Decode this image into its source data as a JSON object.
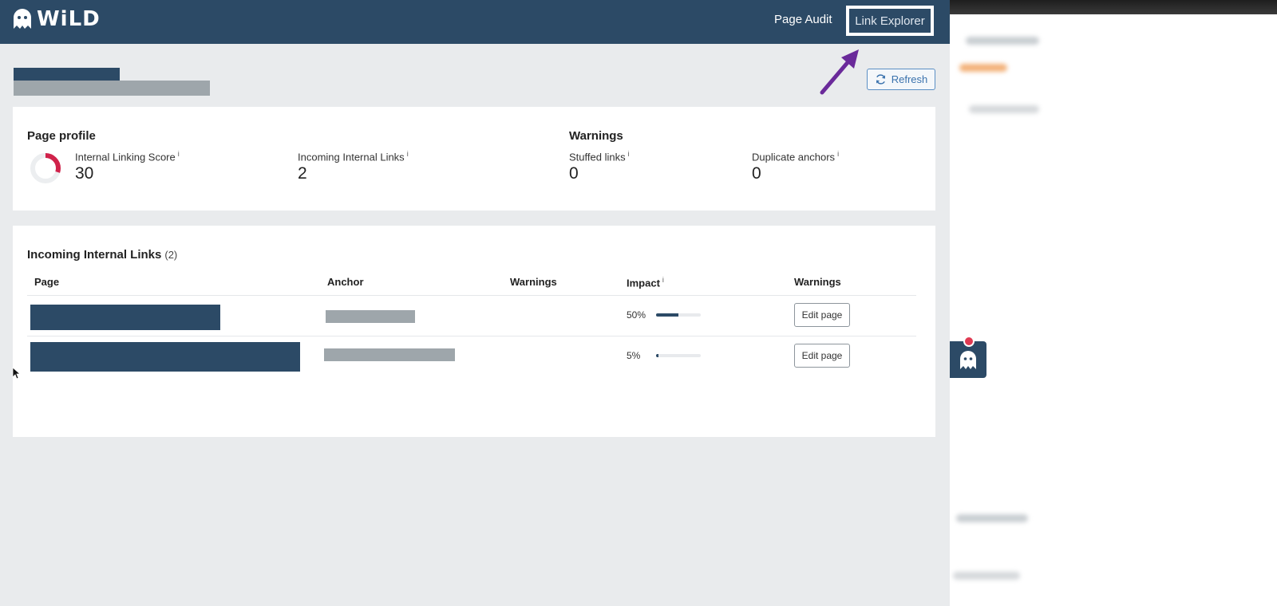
{
  "brand": {
    "logo_text": "WiLD"
  },
  "nav": {
    "page_audit": "Page Audit",
    "link_explorer": "Link Explorer"
  },
  "actions": {
    "refresh_label": "Refresh"
  },
  "page_profile": {
    "title": "Page profile",
    "internal_linking_score": {
      "label": "Internal Linking Score",
      "info": "i",
      "value": "30",
      "score_fraction": 0.3
    },
    "incoming_internal_links": {
      "label": "Incoming Internal Links",
      "info": "i",
      "value": "2"
    }
  },
  "warnings": {
    "title": "Warnings",
    "stuffed_links": {
      "label": "Stuffed links",
      "info": "i",
      "value": "0"
    },
    "duplicate_anchors": {
      "label": "Duplicate anchors",
      "info": "i",
      "value": "0"
    }
  },
  "incoming_links": {
    "title": "Incoming Internal Links",
    "count": "(2)",
    "columns": {
      "page": "Page",
      "anchor": "Anchor",
      "warnings": "Warnings",
      "impact": "Impact",
      "impact_info": "i",
      "warnings2": "Warnings"
    },
    "rows": [
      {
        "impact_label": "50%",
        "impact_fraction": 0.5,
        "action": "Edit page"
      },
      {
        "impact_label": "5%",
        "impact_fraction": 0.05,
        "action": "Edit page"
      }
    ]
  },
  "colors": {
    "brand_navy": "#2c4a66",
    "score_red": "#d0224a",
    "arrow_purple": "#6a2a9a"
  }
}
